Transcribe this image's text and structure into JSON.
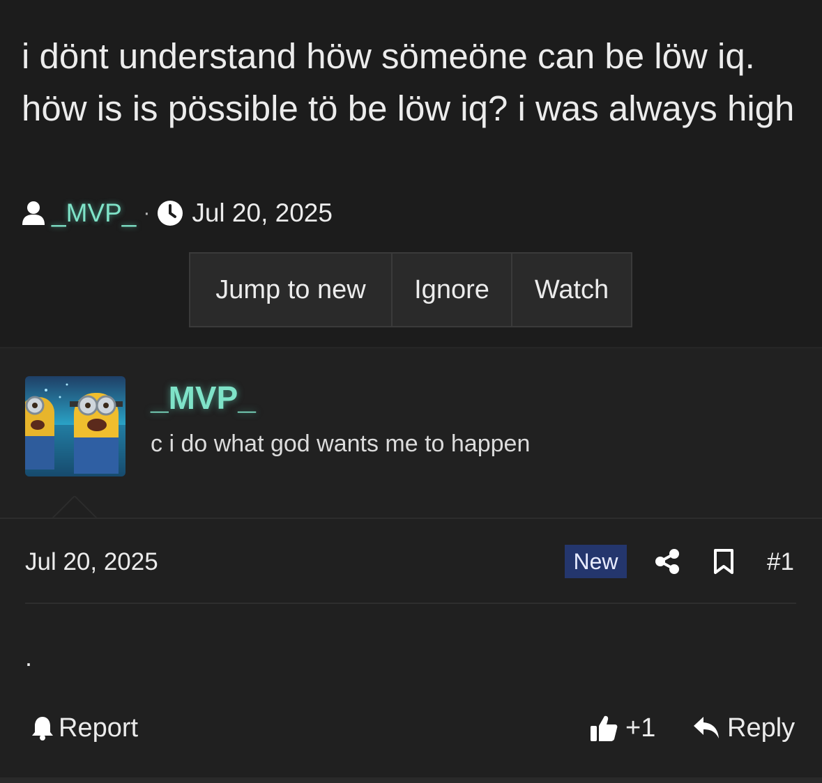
{
  "thread": {
    "title": "i dönt understand höw sömeöne can be löw iq. höw is is pössible tö be löw iq? i was always high",
    "author": "_MVP_",
    "separator": "·",
    "date": "Jul 20, 2025"
  },
  "actions": {
    "jump_to_new": "Jump to new",
    "ignore": "Ignore",
    "watch": "Watch"
  },
  "post": {
    "username": "_MVP_",
    "user_title": "c i do what god wants me to happen",
    "date": "Jul 20, 2025",
    "badge": "New",
    "number": "#1",
    "content": ".",
    "report_label": "Report",
    "reaction_label": "+1",
    "reply_label": "Reply"
  },
  "icons": {
    "author": "user-icon",
    "date": "clock-icon",
    "share": "share-icon",
    "bookmark": "bookmark-icon",
    "report": "bell-icon",
    "reaction": "thumbs-up-icon",
    "reply": "reply-icon"
  },
  "colors": {
    "background": "#1c1c1c",
    "username": "#7fe3c8",
    "badge_new": "#24366d"
  }
}
